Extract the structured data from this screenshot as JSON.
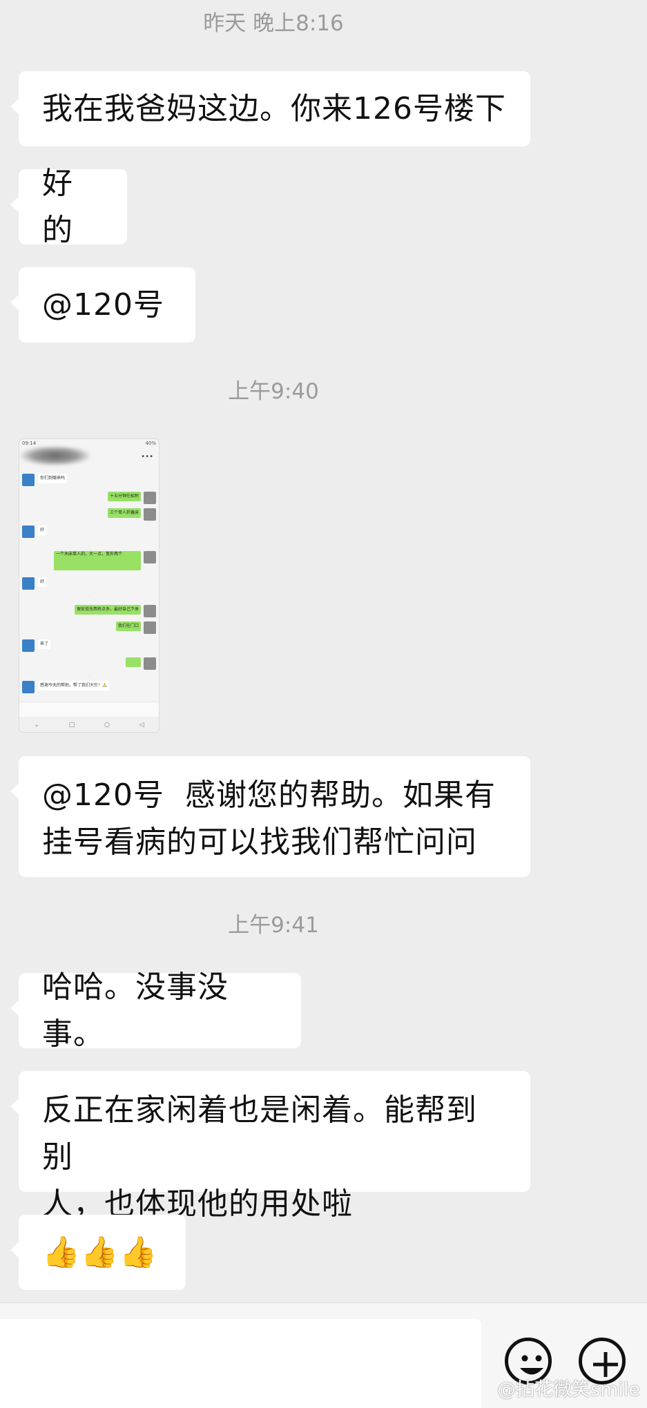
{
  "timestamps": [
    "昨天 晚上8:16",
    "上午9:40",
    "上午9:41"
  ],
  "messages": {
    "m1": "我在我爸妈这边。你来126号楼下",
    "m2": "好的",
    "m3": "@120号",
    "m4": "@120号  感谢您的帮助。如果有\n挂号看病的可以找我们帮忙问问",
    "m5": "哈哈。没事没事。",
    "m6": "反正在家闲着也是闲着。能帮到别\n人，也体现他的用处啦",
    "m7": "👍👍👍"
  },
  "image_message": {
    "status_time": "09:14",
    "status_battery": "40%",
    "rows": [
      {
        "side": "left",
        "text": "你们到哪来吗"
      },
      {
        "side": "right",
        "text": "十五分钟在松附"
      },
      {
        "side": "right",
        "text": "三个单人折叠床"
      },
      {
        "side": "left",
        "text": "好"
      },
      {
        "side": "right",
        "text": "一个木床单人的，大一点，宽外两个"
      },
      {
        "side": "left",
        "text": "好"
      },
      {
        "side": "right",
        "text": "保安说东西有点多，最好自己下来"
      },
      {
        "side": "right",
        "text": "我们在门口"
      },
      {
        "side": "left",
        "text": "来了"
      },
      {
        "side": "right",
        "text": "  "
      },
      {
        "side": "left",
        "text": "感谢今天的帮助，帮了我们大忙！🙏"
      }
    ]
  },
  "input_bar": {
    "placeholder": "",
    "emoji_icon": "smiley-face-icon",
    "plus_icon": "plus-circle-icon"
  },
  "watermark": "@拈花微笑smile"
}
